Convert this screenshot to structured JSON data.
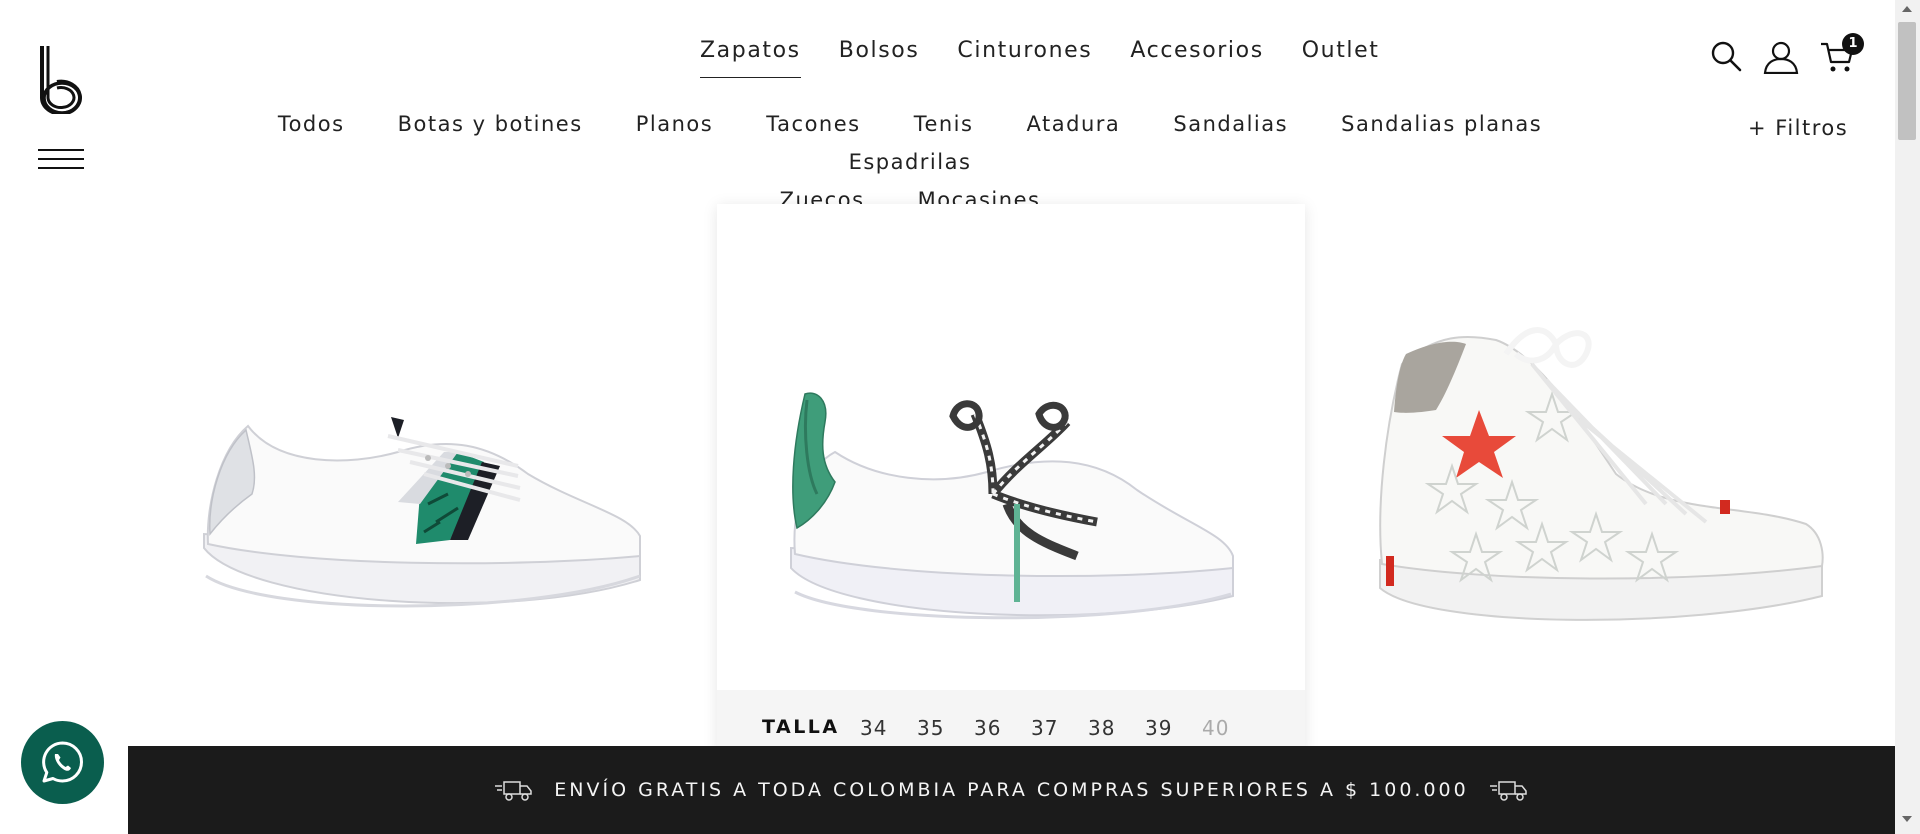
{
  "header": {
    "logo": "b-logo",
    "top_nav": [
      {
        "label": "Zapatos",
        "active": true
      },
      {
        "label": "Bolsos",
        "active": false
      },
      {
        "label": "Cinturones",
        "active": false
      },
      {
        "label": "Accesorios",
        "active": false
      },
      {
        "label": "Outlet",
        "active": false
      }
    ],
    "sub_nav": [
      "Todos",
      "Botas y botines",
      "Planos",
      "Tacones",
      "Tenis",
      "Atadura",
      "Sandalias",
      "Sandalias planas",
      "Espadrilas",
      "Zuecos",
      "Mocasines"
    ],
    "filters_label": "+ Filtros",
    "cart_count": "1",
    "icons": [
      "search-icon",
      "user-icon",
      "cart-icon",
      "hamburger-menu-icon"
    ]
  },
  "products": [
    {
      "name": "white-sneaker-green-snake-stripe",
      "image": "sneaker-icon"
    },
    {
      "name": "white-sneaker-zebra-laces",
      "image": "sneaker-icon",
      "size_label": "TALLA",
      "sizes": [
        "34",
        "35",
        "36",
        "37",
        "38",
        "39",
        "40"
      ],
      "unavailable": [
        "40"
      ]
    },
    {
      "name": "white-high-top-stars",
      "image": "high-top-sneaker-icon"
    }
  ],
  "banner": {
    "text": "ENVÍO GRATIS A TODA COLOMBIA PARA COMPRAS SUPERIORES A $ 100.000",
    "icon": "delivery-truck-icon"
  },
  "whatsapp": {
    "icon": "whatsapp-icon"
  },
  "colors": {
    "banner_bg": "#1b1b1b",
    "whatsapp_bg": "#0a5e4e",
    "accent_green": "#2f9a72",
    "star_red": "#e84a3a"
  }
}
